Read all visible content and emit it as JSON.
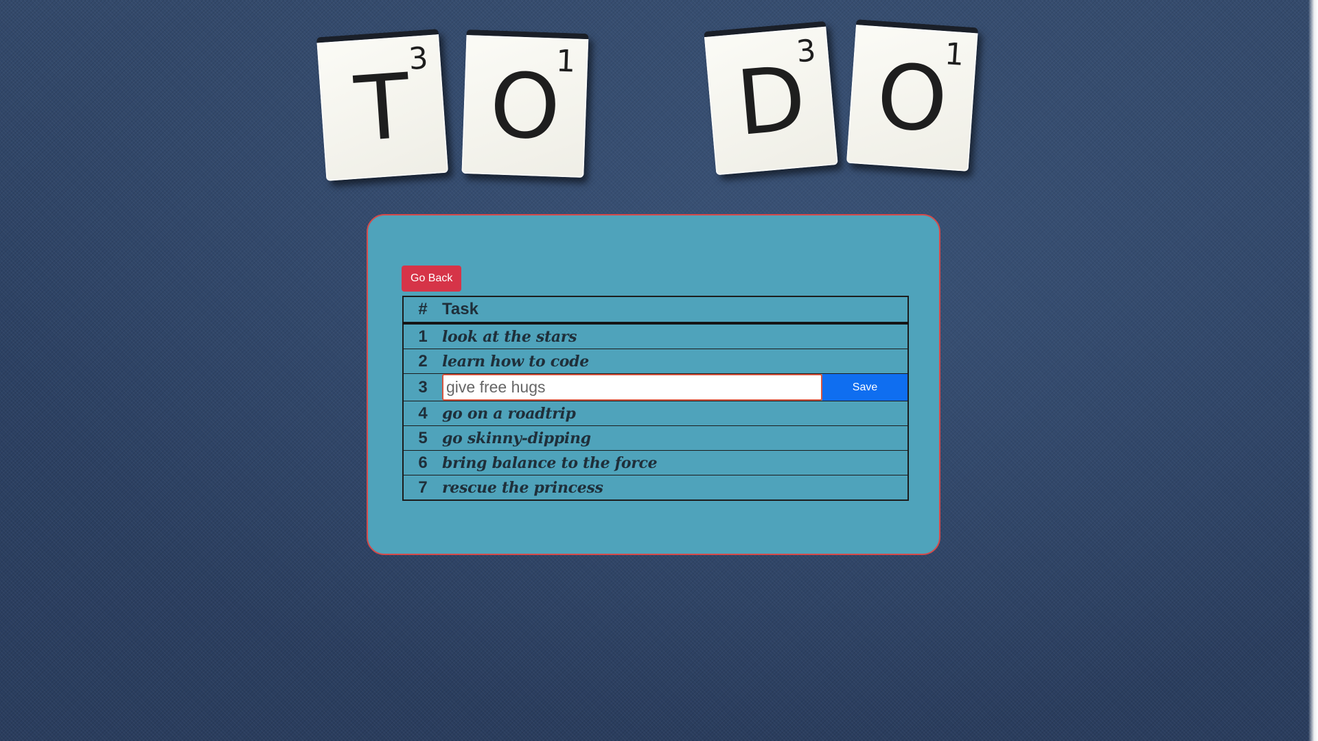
{
  "tiles": [
    {
      "letter": "T",
      "score": "3"
    },
    {
      "letter": "O",
      "score": "1"
    },
    {
      "letter": "D",
      "score": "3"
    },
    {
      "letter": "O",
      "score": "1"
    }
  ],
  "panel": {
    "go_back_label": "Go Back",
    "colors": {
      "panel_bg": "#4fa3bb",
      "panel_border": "#d64a4a",
      "go_back_bg": "#d63448",
      "save_bg": "#0f6ef0"
    }
  },
  "table": {
    "headers": {
      "num": "#",
      "task": "Task"
    },
    "rows": [
      {
        "num": "1",
        "task": "look at the stars"
      },
      {
        "num": "2",
        "task": "learn how to code"
      },
      {
        "num": "3",
        "edit": {
          "placeholder": "give free hugs",
          "value": "",
          "save_label": "Save"
        }
      },
      {
        "num": "4",
        "task": "go on a roadtrip"
      },
      {
        "num": "5",
        "task": "go skinny-dipping"
      },
      {
        "num": "6",
        "task": "bring balance to the force"
      },
      {
        "num": "7",
        "task": "rescue the princess"
      }
    ]
  }
}
